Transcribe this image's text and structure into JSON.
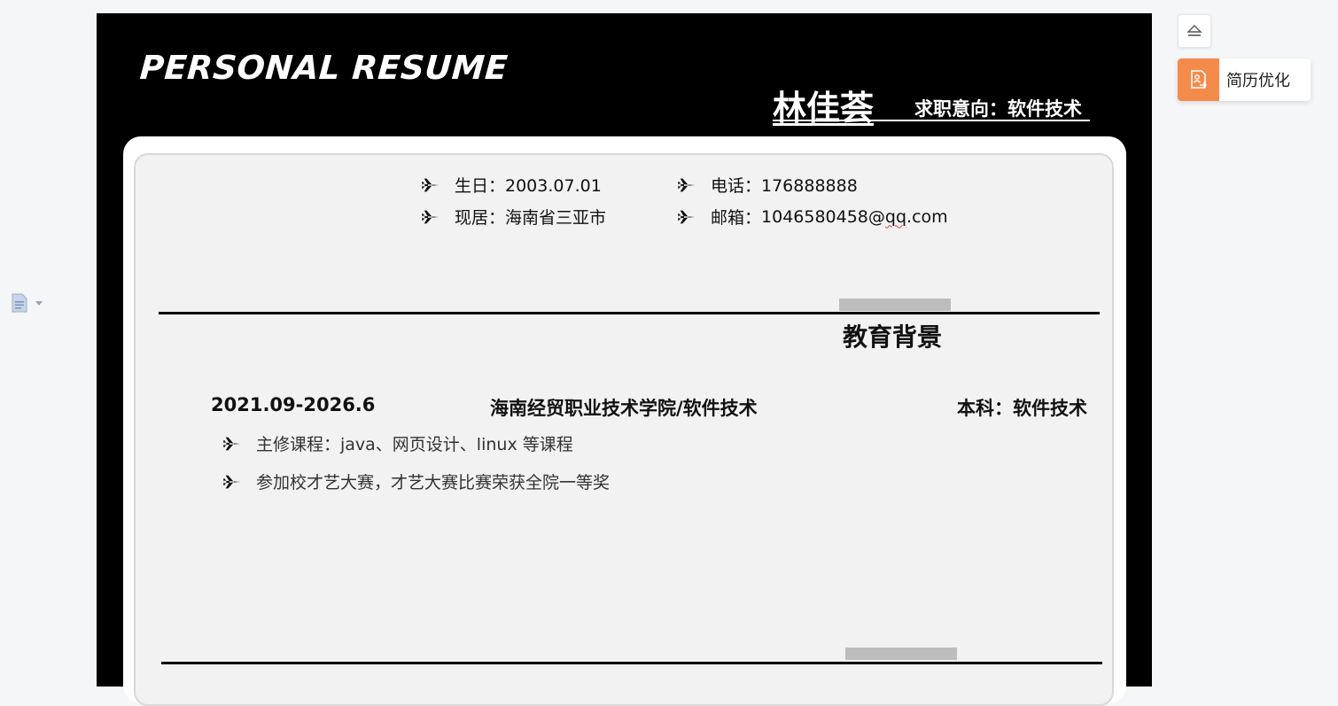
{
  "header": {
    "title": "PERSONAL RESUME",
    "name": "林佳荟",
    "job_intent": "求职意向：软件技术"
  },
  "info": {
    "birthday": "生日：2003.07.01",
    "phone": "电话：176888888",
    "residence": "现居：海南省三亚市",
    "email_label": "邮箱：",
    "email_value_main": "1046580458@",
    "email_value_domain": "qq",
    "email_value_tail": ".com"
  },
  "education": {
    "section_title": "教育背景",
    "period": "2021.09-2026.6",
    "school": "海南经贸职业技术学院/软件技术",
    "degree": "本科：软件技术",
    "bullets": [
      "主修课程：java、网页设计、linux 等课程",
      "参加校才艺大赛，才艺大赛比赛荣获全院一等奖"
    ]
  },
  "sidebar": {
    "optimize_label": "简历优化"
  },
  "colors": {
    "accent": "#f58b4b",
    "page_bg": "#000000",
    "card_bg": "#f2f2f2"
  }
}
